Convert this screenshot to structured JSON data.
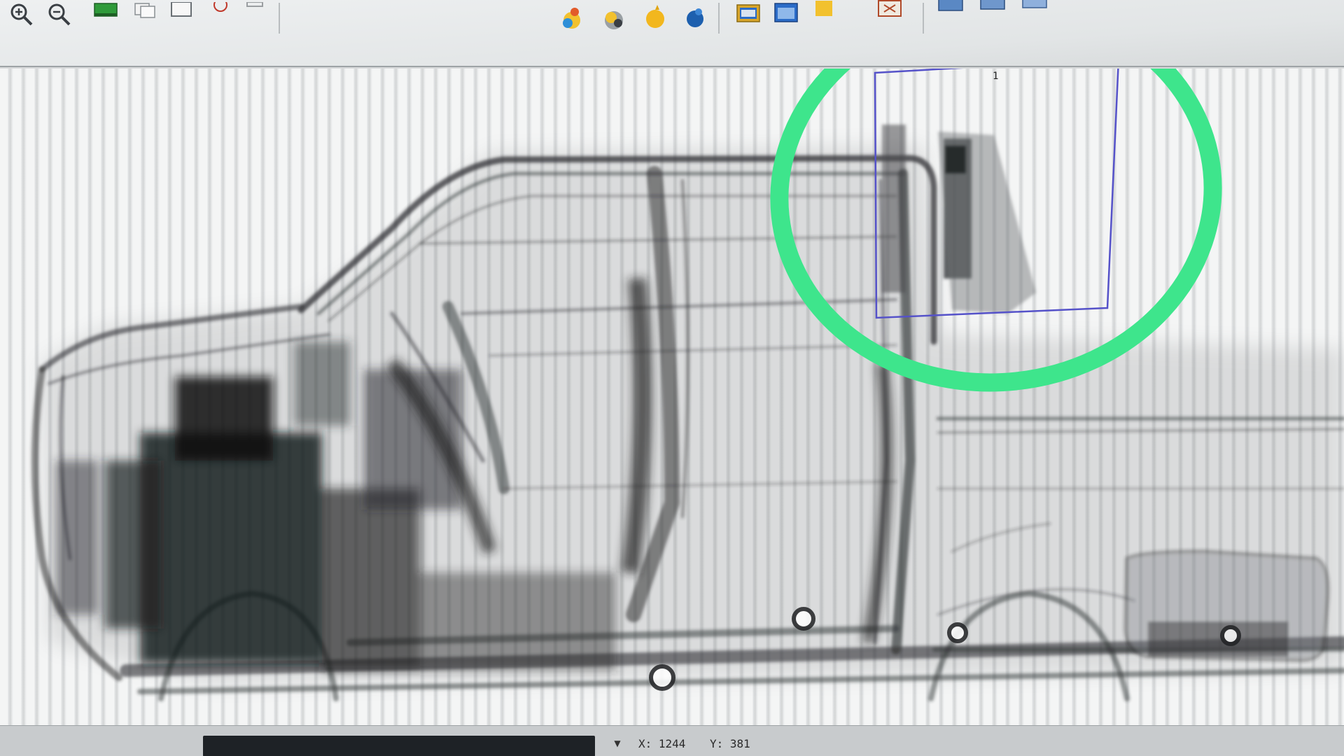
{
  "toolbar": {
    "tools": [
      {
        "name": "zoom-in-icon"
      },
      {
        "name": "zoom-out-icon"
      },
      {
        "name": "fit-image-icon"
      },
      {
        "name": "copy-icon"
      },
      {
        "name": "window-icon"
      },
      {
        "name": "color-palette-icon"
      },
      {
        "name": "pseudo-color-icon"
      },
      {
        "name": "organic-filter-icon"
      },
      {
        "name": "inorganic-filter-icon"
      },
      {
        "name": "image-window-icon"
      },
      {
        "name": "image-view-icon"
      },
      {
        "name": "folder-icon"
      },
      {
        "name": "mark-icon"
      },
      {
        "name": "display-mode-1-icon"
      },
      {
        "name": "display-mode-2-icon"
      },
      {
        "name": "display-mode-3-icon"
      }
    ]
  },
  "viewer": {
    "selection_box": {
      "label": "1"
    },
    "highlight": {
      "color": "#3ee58c"
    },
    "selection_color": "#5552c9"
  },
  "statusbar": {
    "x_label": "X: 1244",
    "y_label": "Y: 381"
  }
}
